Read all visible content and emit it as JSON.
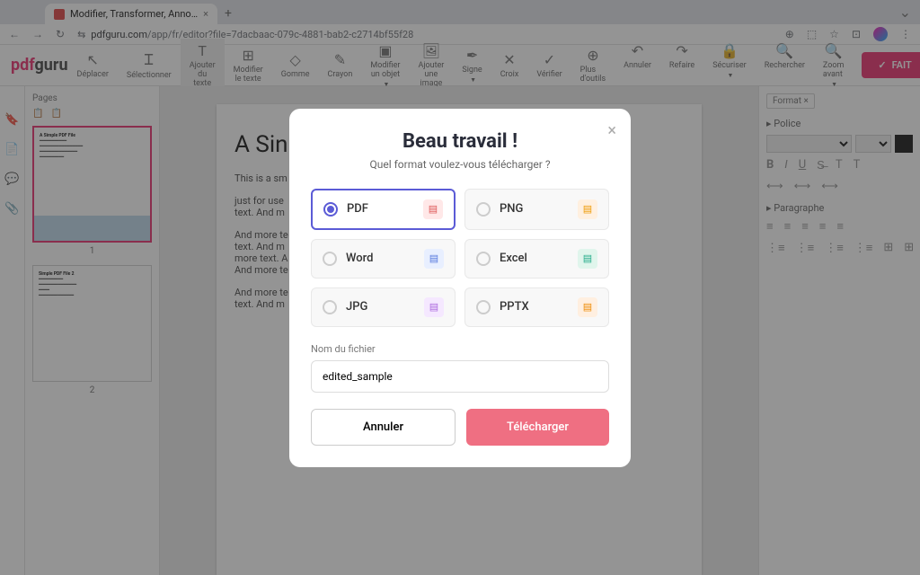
{
  "browser": {
    "tab_title": "Modifier, Transformer, Anno…",
    "url_prefix": "pdfguru.com",
    "url_path": "/app/fr/editor?file=7dacbaac-079c-4881-bab2-c2714bf55f28"
  },
  "logo": {
    "pdf": "pdf",
    "guru": "guru"
  },
  "toolbar": {
    "move": "Déplacer",
    "select": "Sélectionner",
    "add_text": "Ajouter\ndu texte",
    "edit_text": "Modifier\nle texte",
    "eraser": "Gomme",
    "pencil": "Crayon",
    "edit_obj": "Modifier\nun objet",
    "add_img": "Ajouter\nune image",
    "sign": "Signe",
    "cross": "Croix",
    "check": "Vérifier",
    "more": "Plus d'outils",
    "undo": "Annuler",
    "redo": "Refaire",
    "secure": "Sécuriser",
    "search": "Rechercher",
    "zoom": "Zoom avant",
    "done": "FAIT"
  },
  "pages": {
    "header": "Pages",
    "p1": "1",
    "p2": "2",
    "t1": "A Simple PDF File",
    "t2": "Simple PDF File 2"
  },
  "doc": {
    "title": "A Sin",
    "l1": "This is a sm",
    "l2": "just for use",
    "l3": "text. And m",
    "l4": "And more te",
    "l5": "text. And m",
    "l6": "more text. A",
    "l7": "And more te",
    "l8": "And more te",
    "l9": "text. And m"
  },
  "props": {
    "format_tab": "Format ×",
    "police": "Police",
    "para": "Paragraphe"
  },
  "modal": {
    "title": "Beau travail !",
    "subtitle": "Quel format voulez-vous télécharger ?",
    "pdf": "PDF",
    "png": "PNG",
    "word": "Word",
    "excel": "Excel",
    "jpg": "JPG",
    "pptx": "PPTX",
    "filename_label": "Nom du fichier",
    "filename": "edited_sample",
    "cancel": "Annuler",
    "download": "Télécharger"
  }
}
